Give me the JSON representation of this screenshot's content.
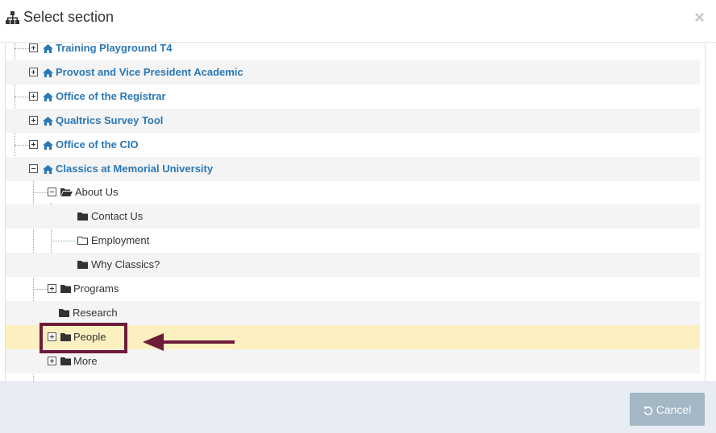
{
  "dialog": {
    "title": "Select section",
    "title_icon": "sitemap-icon",
    "close_glyph": "×"
  },
  "tree": {
    "sites": [
      {
        "label": "Training Playground T4",
        "icon": "home-icon",
        "toggle": "expand"
      },
      {
        "label": "Provost and Vice President Academic",
        "icon": "home-icon",
        "toggle": "expand"
      },
      {
        "label": "Office of the Registrar",
        "icon": "home-icon",
        "toggle": "expand"
      },
      {
        "label": "Qualtrics Survey Tool",
        "icon": "home-icon",
        "toggle": "expand"
      },
      {
        "label": "Office of the CIO",
        "icon": "home-icon",
        "toggle": "expand"
      },
      {
        "label": "Classics at Memorial University",
        "icon": "home-icon",
        "toggle": "collapse"
      }
    ],
    "sections": [
      {
        "label": "About Us",
        "icon": "folder-open-icon",
        "toggle": "collapse"
      },
      {
        "label": "Contact Us",
        "icon": "folder-icon"
      },
      {
        "label": "Employment",
        "icon": "folder-outline-icon"
      },
      {
        "label": "Why Classics?",
        "icon": "folder-icon"
      },
      {
        "label": "Programs",
        "icon": "folder-icon",
        "toggle": "expand"
      },
      {
        "label": "Research",
        "icon": "folder-icon"
      },
      {
        "label": "People",
        "icon": "folder-icon",
        "toggle": "expand",
        "selected": true
      },
      {
        "label": "More",
        "icon": "folder-icon",
        "toggle": "expand"
      }
    ]
  },
  "footer": {
    "cancel_label": "Cancel",
    "cancel_icon": "undo-icon"
  },
  "colors": {
    "site_link": "#2a78b5",
    "selected_row": "#fdf0c0",
    "annotation": "#6f1b3a",
    "cancel_button": "#a3b7c4"
  }
}
